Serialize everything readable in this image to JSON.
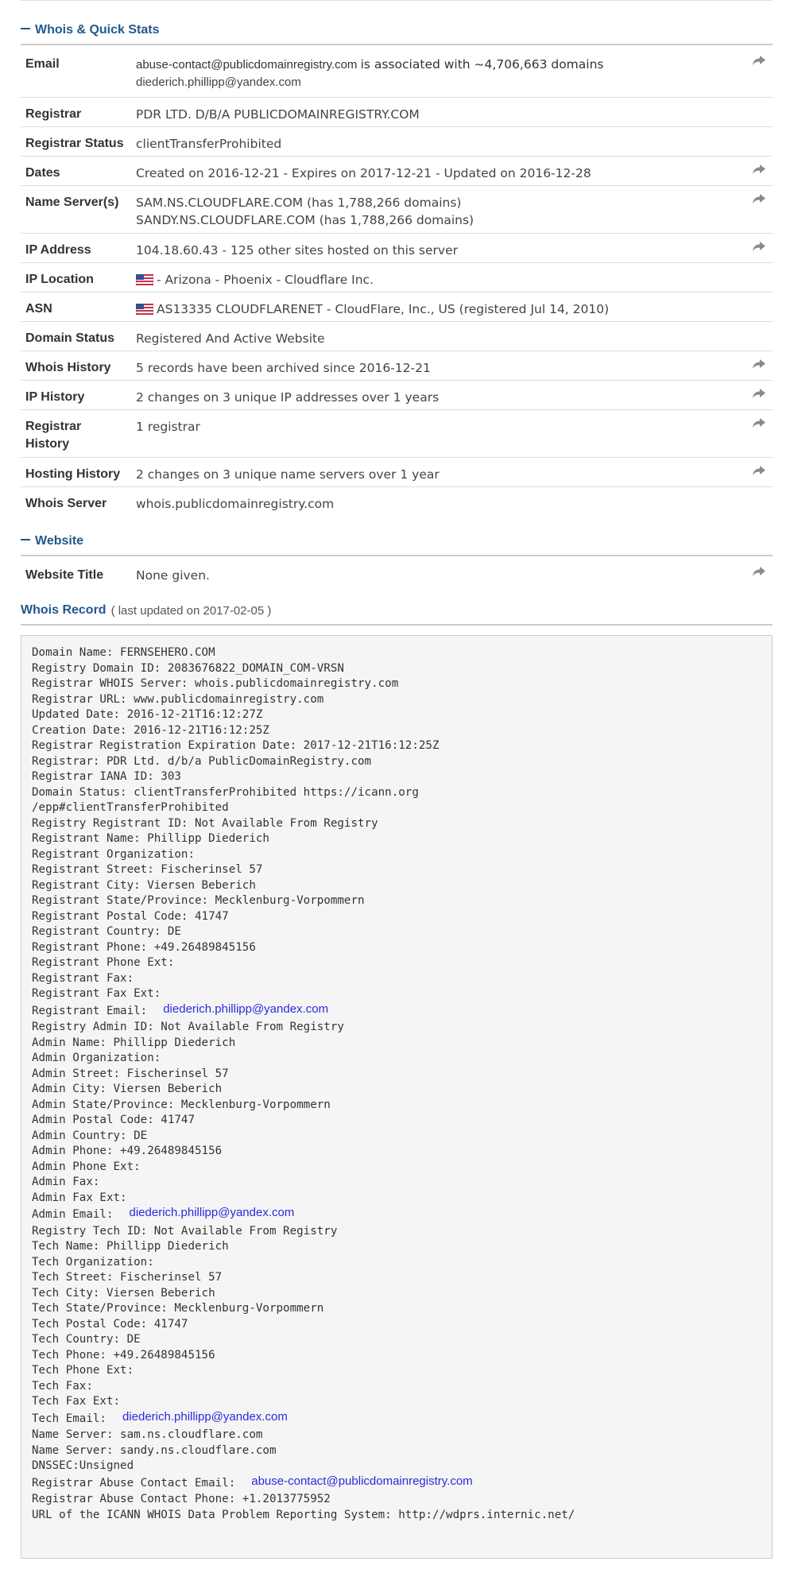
{
  "whois_section": {
    "title": "Whois & Quick Stats"
  },
  "website_section": {
    "title": "Website"
  },
  "record_section": {
    "title": "Whois Record",
    "subtitle": "( last updated on 2017-02-05 )"
  },
  "stats": {
    "email": {
      "label": "Email",
      "address": "abuse-contact@publicdomainregistry.com",
      "suffix": "is associated with ~4,706,663 domains",
      "address2": "diederich.phillipp@yandex.com"
    },
    "registrar": {
      "label": "Registrar",
      "value": "PDR LTD. D/B/A PUBLICDOMAINREGISTRY.COM"
    },
    "registrar_status": {
      "label": "Registrar Status",
      "value": "clientTransferProhibited"
    },
    "dates": {
      "label": "Dates",
      "value": "Created on 2016-12-21 - Expires on 2017-12-21 - Updated on 2016-12-28"
    },
    "name_servers": {
      "label": "Name Server(s)",
      "line1": "SAM.NS.CLOUDFLARE.COM (has 1,788,266 domains)",
      "line2": "SANDY.NS.CLOUDFLARE.COM (has 1,788,266 domains)"
    },
    "ip_address": {
      "label": "IP Address",
      "value": "104.18.60.43 - 125 other sites hosted on this server"
    },
    "ip_location": {
      "label": "IP Location",
      "value": "- Arizona - Phoenix - Cloudflare Inc."
    },
    "asn": {
      "label": "ASN",
      "value": "AS13335 CLOUDFLARENET - CloudFlare, Inc., US (registered Jul 14, 2010)"
    },
    "domain_status": {
      "label": "Domain Status",
      "value": "Registered And Active Website"
    },
    "whois_history": {
      "label": "Whois History",
      "value": "5 records have been archived since 2016-12-21"
    },
    "ip_history": {
      "label": "IP History",
      "value": "2 changes on 3 unique IP addresses over 1 years"
    },
    "registrar_history": {
      "label_line1": "Registrar",
      "label_line2": "History",
      "value": "1 registrar"
    },
    "hosting_history": {
      "label": "Hosting History",
      "value": "2 changes on 3 unique name servers over 1 year"
    },
    "whois_server": {
      "label": "Whois Server",
      "value": "whois.publicdomainregistry.com"
    }
  },
  "website": {
    "title_label": "Website Title",
    "title_value": "None given."
  },
  "icons": {
    "share": "share-arrow-icon",
    "flag": "us-flag-icon"
  },
  "colors": {
    "heading": "#24588a",
    "link": "#2a2ae0",
    "record_bg": "#f5f5f5"
  },
  "record_lines": [
    {
      "text": "Domain Name: FERNSEHERO.COM"
    },
    {
      "text": "Registry Domain ID: 2083676822_DOMAIN_COM-VRSN"
    },
    {
      "text": "Registrar WHOIS Server: whois.publicdomainregistry.com"
    },
    {
      "text": "Registrar URL: www.publicdomainregistry.com"
    },
    {
      "text": "Updated Date: 2016-12-21T16:12:27Z"
    },
    {
      "text": "Creation Date: 2016-12-21T16:12:25Z"
    },
    {
      "text": "Registrar Registration Expiration Date: 2017-12-21T16:12:25Z"
    },
    {
      "text": "Registrar: PDR Ltd. d/b/a PublicDomainRegistry.com"
    },
    {
      "text": "Registrar IANA ID: 303"
    },
    {
      "text": "Domain Status: clientTransferProhibited https://icann.org"
    },
    {
      "text": "/epp#clientTransferProhibited"
    },
    {
      "text": "Registry Registrant ID: Not Available From Registry"
    },
    {
      "text": "Registrant Name: Phillipp Diederich"
    },
    {
      "text": "Registrant Organization:"
    },
    {
      "text": "Registrant Street: Fischerinsel 57"
    },
    {
      "text": "Registrant City: Viersen Beberich"
    },
    {
      "text": "Registrant State/Province: Mecklenburg-Vorpommern"
    },
    {
      "text": "Registrant Postal Code: 41747"
    },
    {
      "text": "Registrant Country: DE"
    },
    {
      "text": "Registrant Phone: +49.26489845156"
    },
    {
      "text": "Registrant Phone Ext:"
    },
    {
      "text": "Registrant Fax:"
    },
    {
      "text": "Registrant Fax Ext:"
    },
    {
      "text": "Registrant Email:",
      "email": "diederich.phillipp@yandex.com"
    },
    {
      "text": "Registry Admin ID: Not Available From Registry"
    },
    {
      "text": "Admin Name: Phillipp Diederich"
    },
    {
      "text": "Admin Organization:"
    },
    {
      "text": "Admin Street: Fischerinsel 57"
    },
    {
      "text": "Admin City: Viersen Beberich"
    },
    {
      "text": "Admin State/Province: Mecklenburg-Vorpommern"
    },
    {
      "text": "Admin Postal Code: 41747"
    },
    {
      "text": "Admin Country: DE"
    },
    {
      "text": "Admin Phone: +49.26489845156"
    },
    {
      "text": "Admin Phone Ext:"
    },
    {
      "text": "Admin Fax:"
    },
    {
      "text": "Admin Fax Ext:"
    },
    {
      "text": "Admin Email:",
      "email": "diederich.phillipp@yandex.com"
    },
    {
      "text": "Registry Tech ID: Not Available From Registry"
    },
    {
      "text": "Tech Name: Phillipp Diederich"
    },
    {
      "text": "Tech Organization:"
    },
    {
      "text": "Tech Street: Fischerinsel 57"
    },
    {
      "text": "Tech City: Viersen Beberich"
    },
    {
      "text": "Tech State/Province: Mecklenburg-Vorpommern"
    },
    {
      "text": "Tech Postal Code: 41747"
    },
    {
      "text": "Tech Country: DE"
    },
    {
      "text": "Tech Phone: +49.26489845156"
    },
    {
      "text": "Tech Phone Ext:"
    },
    {
      "text": "Tech Fax:"
    },
    {
      "text": "Tech Fax Ext:"
    },
    {
      "text": "Tech Email:",
      "email": "diederich.phillipp@yandex.com"
    },
    {
      "text": "Name Server: sam.ns.cloudflare.com"
    },
    {
      "text": "Name Server: sandy.ns.cloudflare.com"
    },
    {
      "text": "DNSSEC:Unsigned"
    },
    {
      "text": "Registrar Abuse Contact Email:",
      "email": "abuse-contact@publicdomainregistry.com"
    },
    {
      "text": "Registrar Abuse Contact Phone: +1.2013775952"
    },
    {
      "text": "URL of the ICANN WHOIS Data Problem Reporting System: http://wdprs.internic.net/"
    }
  ]
}
